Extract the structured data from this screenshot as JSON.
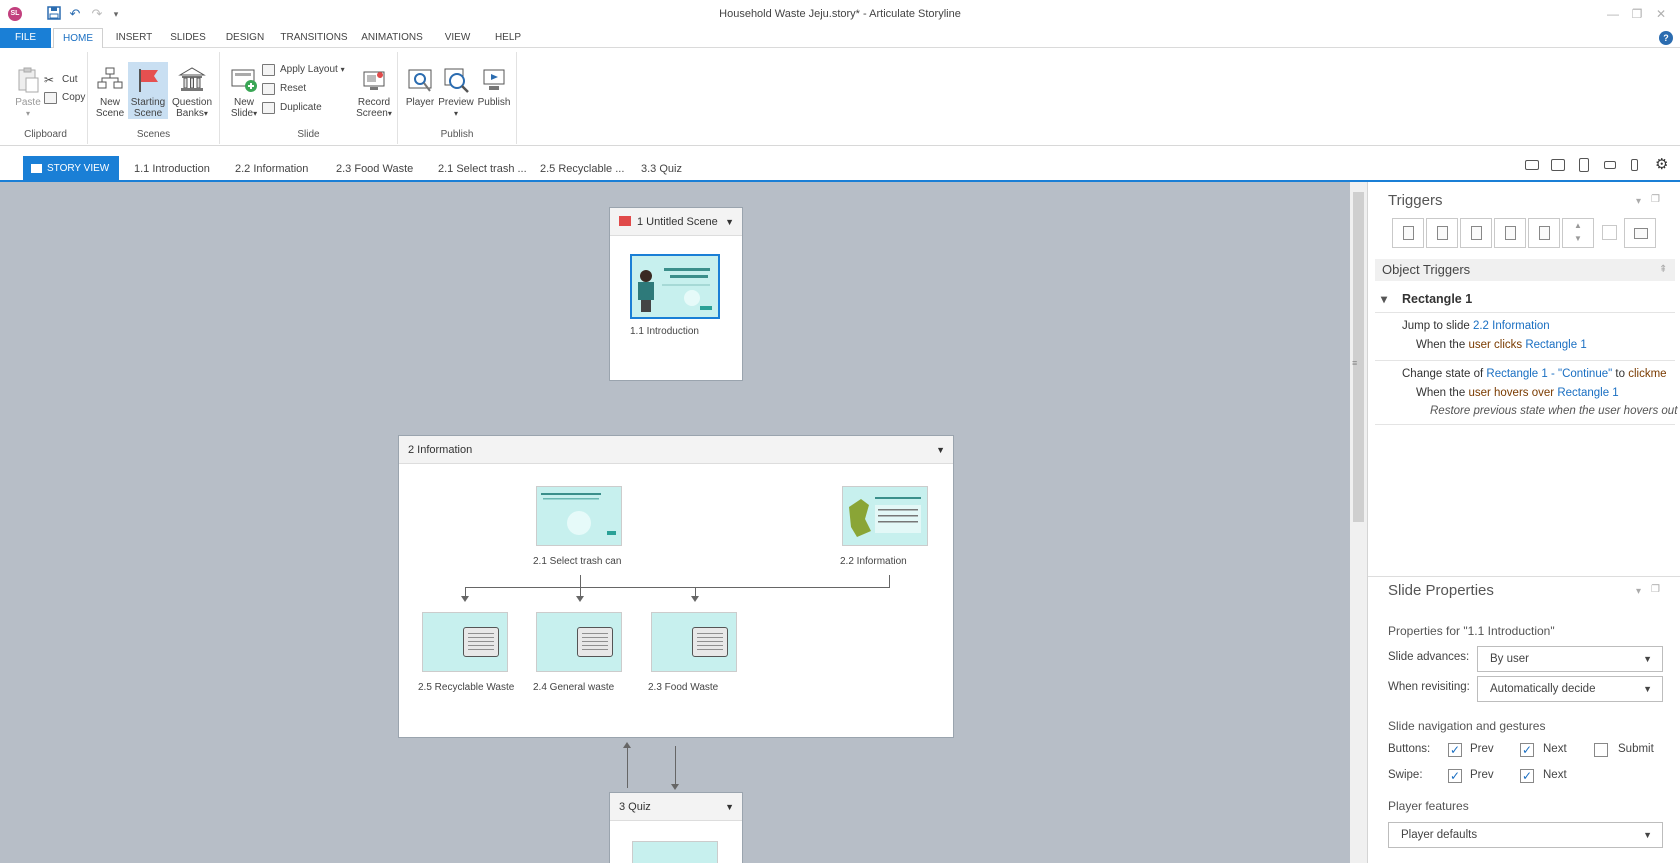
{
  "window": {
    "title": "Household Waste Jeju.story* - Articulate Storyline",
    "logo": "SL"
  },
  "quick_access": {
    "save_icon": "save-icon",
    "undo_icon": "undo-icon",
    "redo_icon": "redo-icon",
    "customize_icon": "chevron-down-icon"
  },
  "ribbon_tabs": [
    "FILE",
    "HOME",
    "INSERT",
    "SLIDES",
    "DESIGN",
    "TRANSITIONS",
    "ANIMATIONS",
    "VIEW",
    "HELP"
  ],
  "ribbon": {
    "clipboard": {
      "label": "Clipboard",
      "paste": "Paste",
      "cut": "Cut",
      "copy": "Copy"
    },
    "scenes": {
      "label": "Scenes",
      "new_scene": [
        "New",
        "Scene"
      ],
      "starting_scene": [
        "Starting",
        "Scene"
      ],
      "question_banks": [
        "Question",
        "Banks"
      ]
    },
    "slide": {
      "label": "Slide",
      "new_slide": [
        "New",
        "Slide"
      ],
      "apply_layout": "Apply Layout",
      "reset": "Reset",
      "duplicate": "Duplicate",
      "record_screen": [
        "Record",
        "Screen"
      ]
    },
    "publish": {
      "label": "Publish",
      "player": "Player",
      "preview": "Preview",
      "publish": "Publish"
    }
  },
  "story_tabs": [
    "STORY VIEW",
    "1.1 Introduction",
    "2.2 Information",
    "2.3 Food Waste",
    "2.1 Select trash ...",
    "2.5 Recyclable ...",
    "3.3 Quiz"
  ],
  "canvas": {
    "scene1": {
      "title": "1 Untitled Scene",
      "slides": [
        "1.1 Introduction"
      ]
    },
    "scene2": {
      "title": "2 Information",
      "slides": [
        "2.1 Select trash can",
        "2.2 Information",
        "2.5 Recyclable Waste",
        "2.4 General waste",
        "2.3 Food Waste"
      ]
    },
    "scene3": {
      "title": "3 Quiz"
    }
  },
  "triggers": {
    "title": "Triggers",
    "section": "Object Triggers",
    "object": "Rectangle 1",
    "t1": {
      "action": "Jump to slide",
      "target": "2.2 Information",
      "when": "When the",
      "who": "user",
      "event": "clicks",
      "obj": "Rectangle 1"
    },
    "t2": {
      "action": "Change state of",
      "target": "Rectangle 1 - \"Continue\"",
      "to": "to",
      "state": "clickme",
      "when": "When the",
      "who": "user",
      "event": "hovers over",
      "obj": "Rectangle 1",
      "note": "Restore previous state when the user hovers out"
    }
  },
  "slide_properties": {
    "title": "Slide Properties",
    "properties_for": "Properties for \"1.1 Introduction\"",
    "advances_label": "Slide advances:",
    "advances_value": "By user",
    "revisiting_label": "When revisiting:",
    "revisiting_value": "Automatically decide",
    "nav_heading": "Slide navigation and gestures",
    "buttons_label": "Buttons:",
    "swipe_label": "Swipe:",
    "prev": "Prev",
    "next": "Next",
    "submit": "Submit",
    "buttons_prev": true,
    "buttons_next": true,
    "buttons_submit": false,
    "swipe_prev": true,
    "swipe_next": true,
    "player_heading": "Player features",
    "player_value": "Player defaults"
  },
  "colors": {
    "accent": "#1a7fd6",
    "canvas": "#b7bec7",
    "link": "#1a6fc2",
    "slide_bg": "#c7f0ee"
  }
}
